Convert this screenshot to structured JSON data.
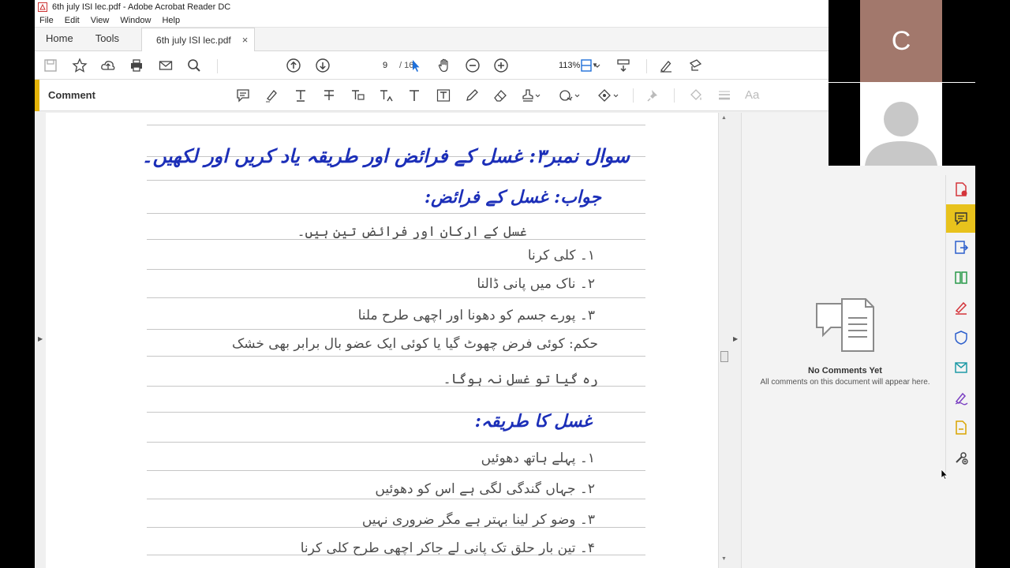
{
  "window": {
    "title": "6th july ISI lec.pdf - Adobe Acrobat Reader DC"
  },
  "menu": [
    "File",
    "Edit",
    "View",
    "Window",
    "Help"
  ],
  "tabs": {
    "home": "Home",
    "tools": "Tools",
    "document": "6th july ISI lec.pdf",
    "close": "×"
  },
  "toolbar": {
    "page_current": "9",
    "page_total": "/ 16",
    "zoom": "113%"
  },
  "commentbar": {
    "label": "Comment",
    "font_label": "Aa"
  },
  "comments_panel": {
    "title": "No Comments Yet",
    "body": "All comments on this document will appear here."
  },
  "video": {
    "participant_initial": "C"
  },
  "document": {
    "lines": [
      {
        "text": "سوال نمبر۳: غسل کے فرائض اور طریقہ یاد کریں اور لکھیں۔",
        "style": "blue"
      },
      {
        "text": "جواب: غسل کے فرائض:",
        "style": "blue"
      },
      {
        "text": "غسل کے ارکان اور فرائض تین ہیں۔",
        "style": "grey"
      },
      {
        "text": "۱۔ کلی کرنا",
        "style": "grey"
      },
      {
        "text": "۲۔ ناک میں پانی ڈالنا",
        "style": "grey"
      },
      {
        "text": "۳۔ پورے جسم کو دھونا اور اچھی طرح ملنا",
        "style": "grey"
      },
      {
        "text": "حکم: کوئی فرض چھوٹ گیا یا کوئی ایک عضو بال برابر بھی خشک",
        "style": "grey"
      },
      {
        "text": "رہ گیا تو غسل نہ ہوگا۔",
        "style": "grey"
      },
      {
        "text": "غسل کا طریقہ:",
        "style": "blue"
      },
      {
        "text": "۱۔ پہلے ہاتھ دھوئیں",
        "style": "grey"
      },
      {
        "text": "۲۔ جہاں گندگی لگی ہے اس کو دھوئیں",
        "style": "grey"
      },
      {
        "text": "۳۔ وضو کر لینا بہتر ہے مگر ضروری نہیں",
        "style": "grey"
      },
      {
        "text": "۴۔ تین بار حلق تک پانی لے جاکر اچھی طرح کلی کرنا",
        "style": "grey"
      }
    ]
  },
  "colors": {
    "accent": "#e5b409",
    "ink_blue": "#1c2fb8",
    "rail_active": "#e8c21c"
  },
  "icons": {
    "toolbar": [
      "save-icon",
      "star-icon",
      "upload-icon",
      "print-icon",
      "email-icon",
      "search-icon",
      "prev-page-icon",
      "next-page-icon",
      "select-icon",
      "hand-icon",
      "zoom-out-icon",
      "zoom-in-icon",
      "page-layout-icon",
      "scroll-mode-icon",
      "sign-icon",
      "share-icon"
    ],
    "rail": [
      "create-pdf-icon",
      "comment-icon",
      "export-pdf-icon",
      "organize-pages-icon",
      "fill-sign-icon",
      "protect-icon",
      "send-review-icon",
      "sign-icon",
      "edit-pdf-icon",
      "more-tools-icon"
    ]
  }
}
